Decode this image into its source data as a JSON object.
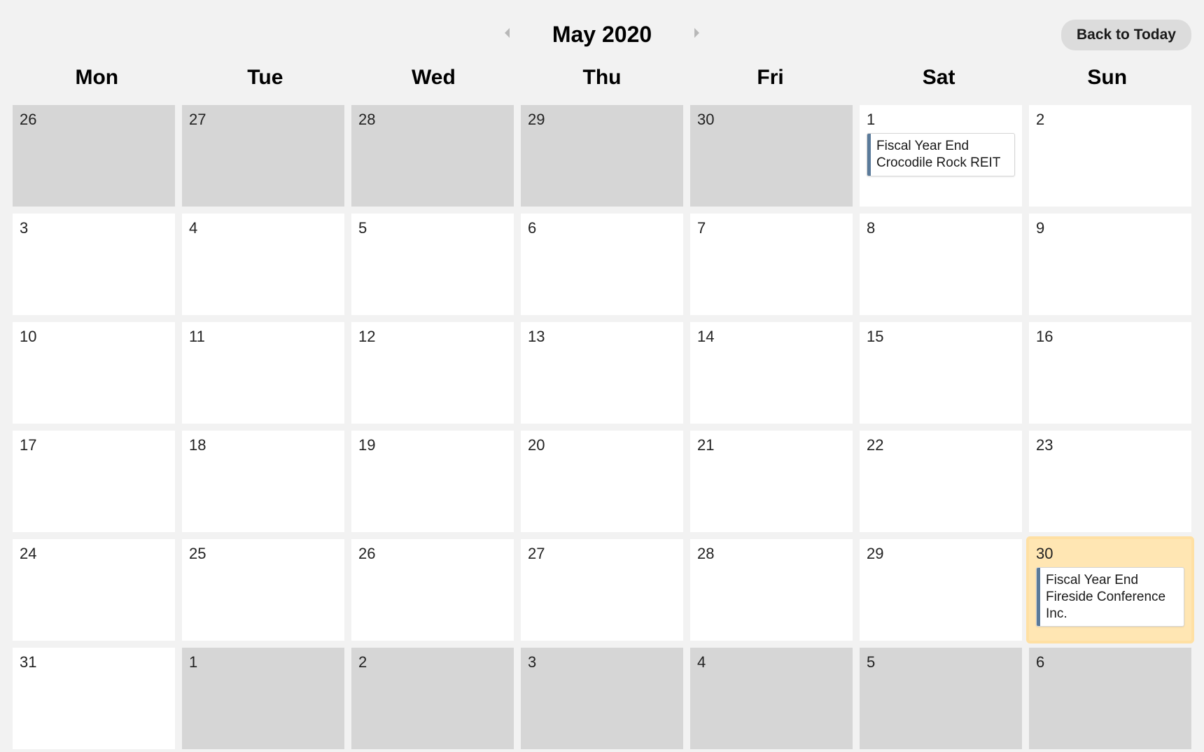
{
  "header": {
    "month_title": "May 2020",
    "back_to_today": "Back to Today"
  },
  "weekdays": [
    "Mon",
    "Tue",
    "Wed",
    "Thu",
    "Fri",
    "Sat",
    "Sun"
  ],
  "days": [
    {
      "num": "26",
      "other_month": true
    },
    {
      "num": "27",
      "other_month": true
    },
    {
      "num": "28",
      "other_month": true
    },
    {
      "num": "29",
      "other_month": true
    },
    {
      "num": "30",
      "other_month": true
    },
    {
      "num": "1",
      "other_month": false,
      "event": {
        "title": "Fiscal Year End",
        "sub": "Crocodile Rock REIT"
      }
    },
    {
      "num": "2",
      "other_month": false
    },
    {
      "num": "3",
      "other_month": false
    },
    {
      "num": "4",
      "other_month": false
    },
    {
      "num": "5",
      "other_month": false
    },
    {
      "num": "6",
      "other_month": false
    },
    {
      "num": "7",
      "other_month": false
    },
    {
      "num": "8",
      "other_month": false
    },
    {
      "num": "9",
      "other_month": false
    },
    {
      "num": "10",
      "other_month": false
    },
    {
      "num": "11",
      "other_month": false
    },
    {
      "num": "12",
      "other_month": false
    },
    {
      "num": "13",
      "other_month": false
    },
    {
      "num": "14",
      "other_month": false
    },
    {
      "num": "15",
      "other_month": false
    },
    {
      "num": "16",
      "other_month": false
    },
    {
      "num": "17",
      "other_month": false
    },
    {
      "num": "18",
      "other_month": false
    },
    {
      "num": "19",
      "other_month": false
    },
    {
      "num": "20",
      "other_month": false
    },
    {
      "num": "21",
      "other_month": false
    },
    {
      "num": "22",
      "other_month": false
    },
    {
      "num": "23",
      "other_month": false
    },
    {
      "num": "24",
      "other_month": false
    },
    {
      "num": "25",
      "other_month": false
    },
    {
      "num": "26",
      "other_month": false
    },
    {
      "num": "27",
      "other_month": false
    },
    {
      "num": "28",
      "other_month": false
    },
    {
      "num": "29",
      "other_month": false
    },
    {
      "num": "30",
      "other_month": false,
      "highlight": true,
      "event": {
        "title": "Fiscal Year End",
        "sub": "Fireside Conference Inc."
      }
    },
    {
      "num": "31",
      "other_month": false
    },
    {
      "num": "1",
      "other_month": true
    },
    {
      "num": "2",
      "other_month": true
    },
    {
      "num": "3",
      "other_month": true
    },
    {
      "num": "4",
      "other_month": true
    },
    {
      "num": "5",
      "other_month": true
    },
    {
      "num": "6",
      "other_month": true
    }
  ],
  "colors": {
    "event_bar": "#5a7a9a",
    "highlight": "#ffe6b3"
  }
}
